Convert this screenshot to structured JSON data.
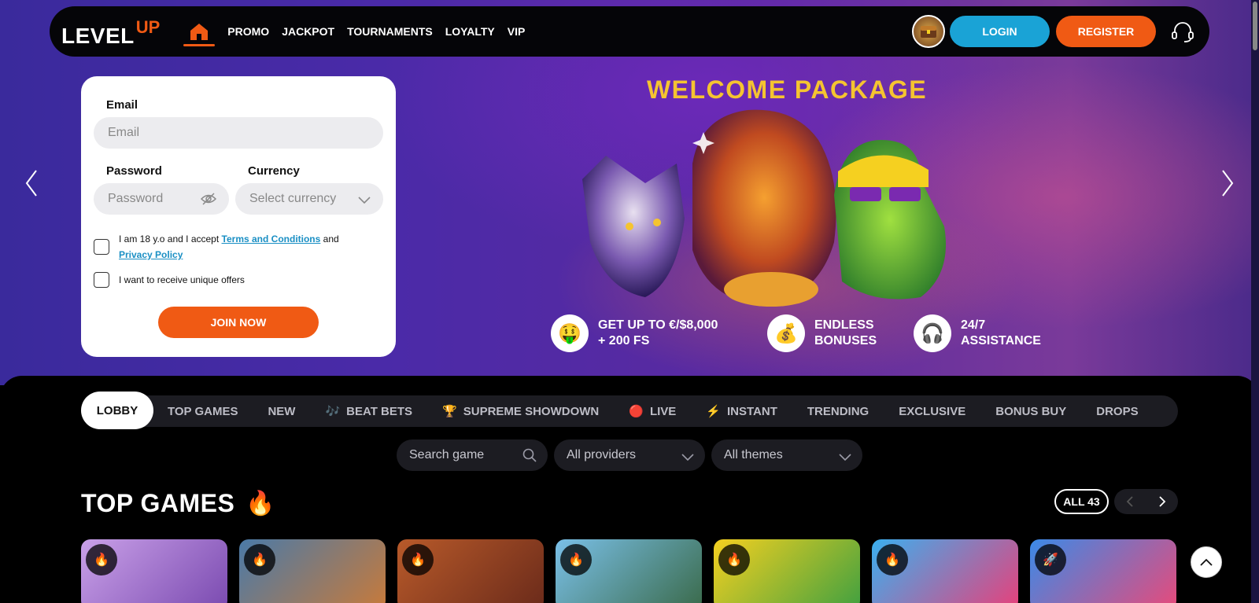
{
  "header": {
    "logo_main": "LEVEL",
    "logo_accent": "UP",
    "home_icon": "home-icon",
    "nav": [
      "PROMO",
      "JACKPOT",
      "TOURNAMENTS",
      "LOYALTY",
      "VIP"
    ],
    "login_label": "LOGIN",
    "register_label": "REGISTER",
    "support_icon": "headset-icon"
  },
  "form": {
    "email_label": "Email",
    "email_placeholder": "Email",
    "password_label": "Password",
    "password_placeholder": "Password",
    "currency_label": "Currency",
    "currency_placeholder": "Select currency",
    "terms_prefix": "I am 18 y.o and I accept",
    "terms_link": "Terms and Conditions",
    "terms_and": "and",
    "privacy_link": "Privacy Policy",
    "offers_text": "I want to receive unique offers",
    "join_label": "JOIN NOW"
  },
  "promo": {
    "title": "WELCOME PACKAGE",
    "perks": [
      {
        "icon": "money-face-emoji",
        "glyph": "🤑",
        "line1": "GET UP TO €/$8,000",
        "line2": "+ 200 FS"
      },
      {
        "icon": "money-bag-emoji",
        "glyph": "💰",
        "line1": "ENDLESS",
        "line2": "BONUSES"
      },
      {
        "icon": "headphones-emoji",
        "glyph": "🎧",
        "line1": "24/7",
        "line2": "ASSISTANCE"
      }
    ]
  },
  "tabs": {
    "active": "LOBBY",
    "items": [
      {
        "label": "TOP GAMES",
        "icon": ""
      },
      {
        "label": "NEW",
        "icon": ""
      },
      {
        "label": "BEAT BETS",
        "icon": "🎶"
      },
      {
        "label": "SUPREME SHOWDOWN",
        "icon": "🏆"
      },
      {
        "label": "LIVE",
        "icon": "🔴"
      },
      {
        "label": "INSTANT",
        "icon": "⚡"
      },
      {
        "label": "TRENDING",
        "icon": ""
      },
      {
        "label": "EXCLUSIVE",
        "icon": ""
      },
      {
        "label": "BONUS BUY",
        "icon": ""
      },
      {
        "label": "DROPS",
        "icon": ""
      }
    ]
  },
  "filters": {
    "search_placeholder": "Search game",
    "providers": "All providers",
    "themes": "All themes"
  },
  "section": {
    "title": "TOP GAMES",
    "title_icon": "🔥",
    "all_label": "ALL 43"
  },
  "games": [
    {
      "name": "olympus-game-card",
      "badge": "🔥",
      "colors": [
        "#c9a0e8",
        "#7a4ab0"
      ]
    },
    {
      "name": "fisherman-game-card",
      "badge": "🔥",
      "colors": [
        "#4a7aa8",
        "#c87a3a"
      ]
    },
    {
      "name": "explorer-game-card",
      "badge": "🔥",
      "colors": [
        "#b85a2a",
        "#6a2a1a"
      ]
    },
    {
      "name": "fishing-game-card",
      "badge": "🔥",
      "colors": [
        "#7ac0e8",
        "#3a6a4a"
      ]
    },
    {
      "name": "frog-game-card",
      "badge": "🔥",
      "colors": [
        "#f5d020",
        "#40a040"
      ]
    },
    {
      "name": "candy-game-card",
      "badge": "🔥",
      "colors": [
        "#3ab0f0",
        "#e8407a"
      ]
    },
    {
      "name": "gumball-game-card",
      "badge": "🚀",
      "colors": [
        "#3a8ae8",
        "#e84a7a"
      ]
    }
  ]
}
